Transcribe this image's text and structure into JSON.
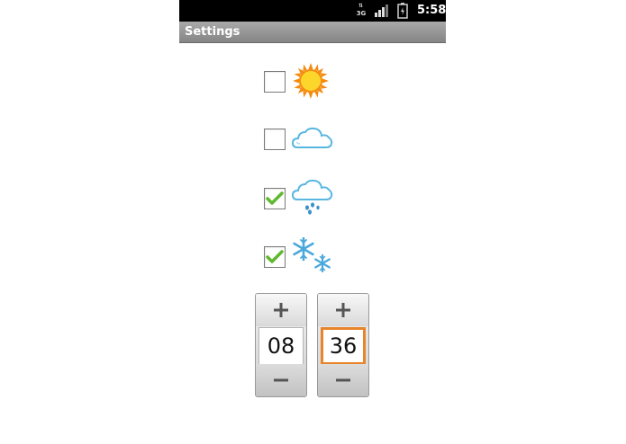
{
  "status_bar": {
    "network": "3G",
    "time": "5:58"
  },
  "title_bar": {
    "title": "Settings"
  },
  "weather_options": [
    {
      "icon": "sun-icon",
      "checked": false
    },
    {
      "icon": "cloud-icon",
      "checked": false
    },
    {
      "icon": "rain-icon",
      "checked": true
    },
    {
      "icon": "snow-icon",
      "checked": true
    }
  ],
  "time_picker": {
    "hour": "08",
    "minute": "36",
    "increment_symbol": "+",
    "decrement_symbol": "−",
    "focused_field": "minute"
  },
  "colors": {
    "check_green": "#5fb82e",
    "focus_orange": "#e8842a",
    "cloud_blue": "#58b6e0",
    "sun_yellow": "#fdd62c",
    "sun_orange": "#f58a0e"
  }
}
